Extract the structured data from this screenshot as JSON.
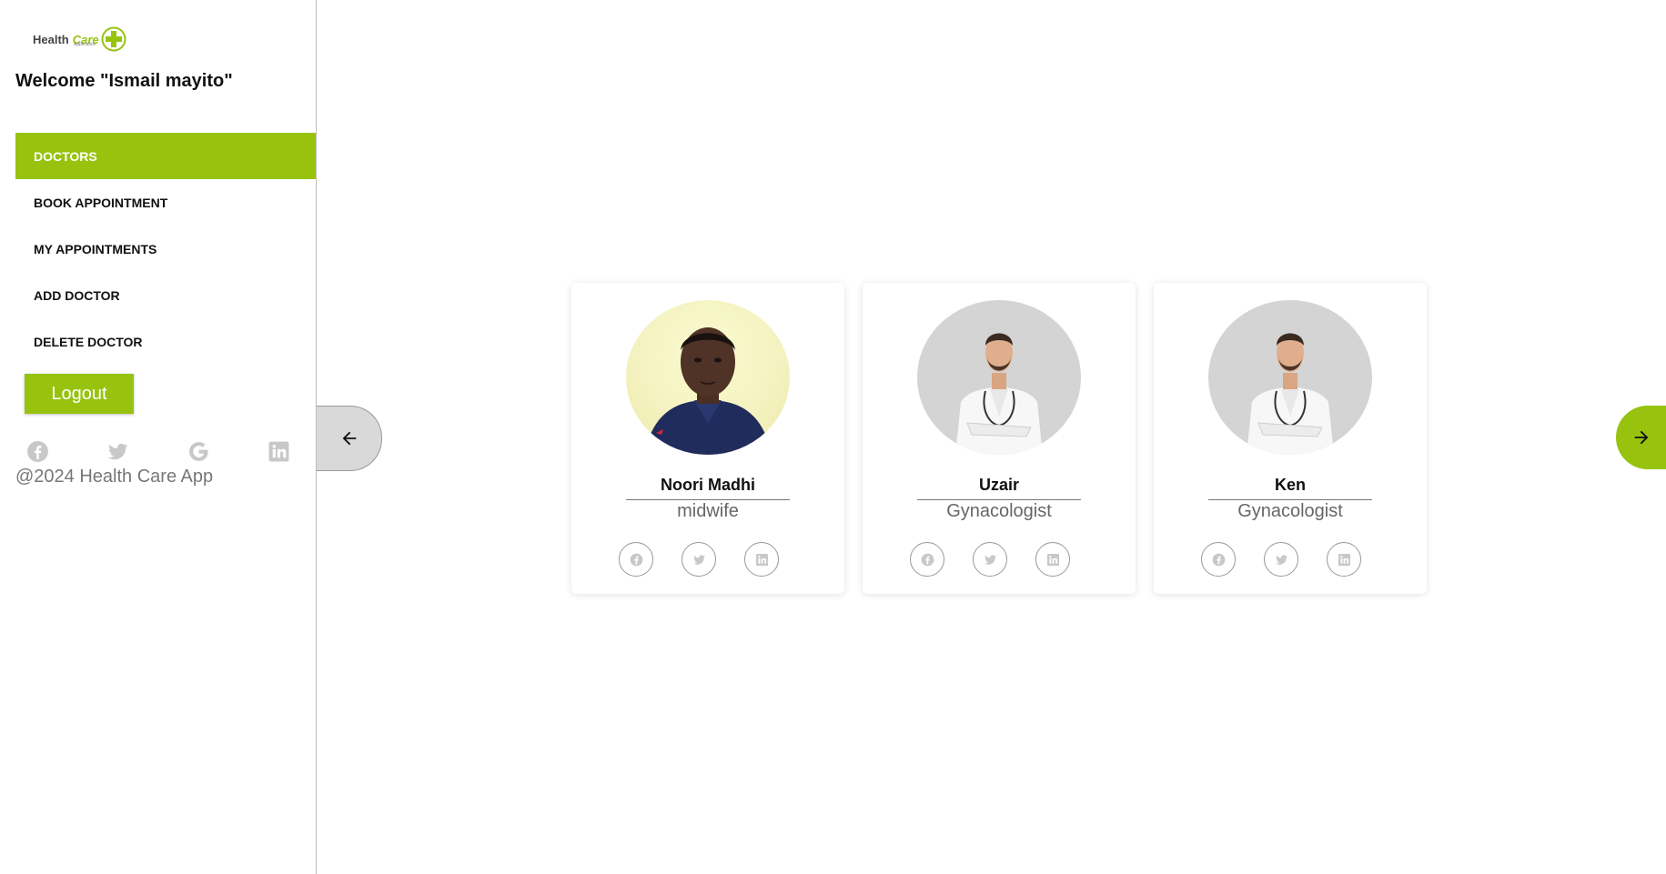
{
  "brand": {
    "name_part1": "Health",
    "name_part2": "Care",
    "tagline": "Application"
  },
  "welcome": "Welcome \"Ismail mayito\"",
  "menu": [
    {
      "label": "DOCTORS",
      "active": true
    },
    {
      "label": "BOOK APPOINTMENT",
      "active": false
    },
    {
      "label": "MY APPOINTMENTS",
      "active": false
    },
    {
      "label": "ADD DOCTOR",
      "active": false
    },
    {
      "label": "DELETE DOCTOR",
      "active": false
    }
  ],
  "logout_label": "Logout",
  "sidebar_social_icons": [
    "facebook-icon",
    "twitter-icon",
    "google-icon",
    "linkedin-icon"
  ],
  "copyright": "@2024 Health Care App",
  "carousel": {
    "prev_icon": "arrow-left-icon",
    "next_icon": "arrow-right-icon"
  },
  "doctors": [
    {
      "name": "Noori Madhi",
      "specialty": "midwife"
    },
    {
      "name": "Uzair",
      "specialty": "Gynacologist"
    },
    {
      "name": "Ken",
      "specialty": "Gynacologist"
    }
  ],
  "colors": {
    "accent": "#97c30f",
    "muted_icon": "#c8c8c8"
  }
}
